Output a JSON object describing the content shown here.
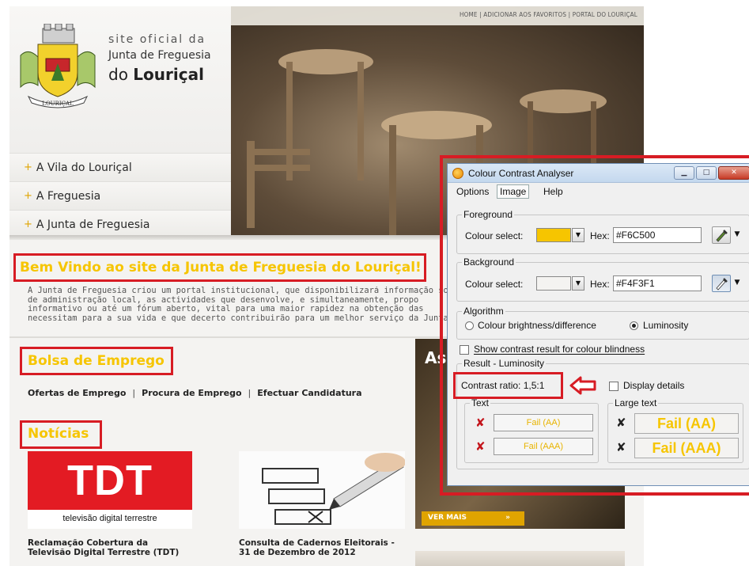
{
  "site": {
    "title_lines": [
      "site oficial da",
      "Junta de Freguesia",
      "do ",
      "Louriçal"
    ],
    "crest_label": "LOURIÇAL",
    "top_links": "HOME | ADICIONAR AOS FAVORITOS | PORTAL DO LOURIÇAL",
    "nav": [
      "A Vila do Louriçal",
      "A Freguesia",
      "A Junta de Freguesia"
    ],
    "welcome_title": "Bem Vindo ao site da Junta de Freguesia do Louriçal!",
    "intro_lines": [
      "A Junta de Freguesia criou um portal institucional, que disponibilizará informação sobre",
      "de administração local, as actividades que desenvolve, e simultaneamente, propo",
      "informativo ou até um fórum aberto, vital para uma maior rapidez na obtenção das",
      "necessitam para a sua vida e que decerto contribuirão para um melhor serviço da Junta"
    ],
    "bolsa_title": "Bolsa de Emprego",
    "job_links": [
      "Ofertas de Emprego",
      "Procura de Emprego",
      "Efectuar Candidatura"
    ],
    "job_sep": "|",
    "noticias_title": "Notícias",
    "news": [
      {
        "image_text": "TDT",
        "image_caption": "televisão digital terrestre",
        "title": "Reclamação Cobertura da Televisão Digital Terrestre (TDT)"
      },
      {
        "title": "Consulta de Cadernos Eleitorais - 31 de Dezembro de 2012"
      }
    ],
    "ad_text": "As",
    "ver_mais": "VER MAIS",
    "ver_mais_arrows": "»"
  },
  "analyzer": {
    "title": "Colour Contrast Analyser",
    "window_buttons": [
      "minimize",
      "maximize",
      "close"
    ],
    "menu": [
      "Options",
      "Image",
      "Help"
    ],
    "foreground": {
      "legend": "Foreground",
      "colour_select_label": "Colour select:",
      "hex_label": "Hex:",
      "hex_value": "#F6C500",
      "swatch_color": "#F6C500"
    },
    "background": {
      "legend": "Background",
      "colour_select_label": "Colour select:",
      "hex_label": "Hex:",
      "hex_value": "#F4F3F1",
      "swatch_color": "#F4F3F1"
    },
    "algorithm": {
      "legend": "Algorithm",
      "options": [
        "Colour brightness/difference",
        "Luminosity"
      ],
      "selected": "Luminosity"
    },
    "colour_blindness_label": "Show contrast result for colour blindness",
    "result": {
      "legend": "Result - Luminosity",
      "contrast_ratio_label": "Contrast ratio: 1,5:1",
      "display_details_label": "Display details",
      "text_legend": "Text",
      "text_results": [
        "Fail (AA)",
        "Fail (AAA)"
      ],
      "large_text_legend": "Large text",
      "large_text_results": [
        "Fail (AA)",
        "Fail (AAA)"
      ]
    }
  },
  "colors": {
    "highlight_red": "#d71c24",
    "title_yellow": "#f6c500",
    "tdt_red": "#e31b23"
  }
}
